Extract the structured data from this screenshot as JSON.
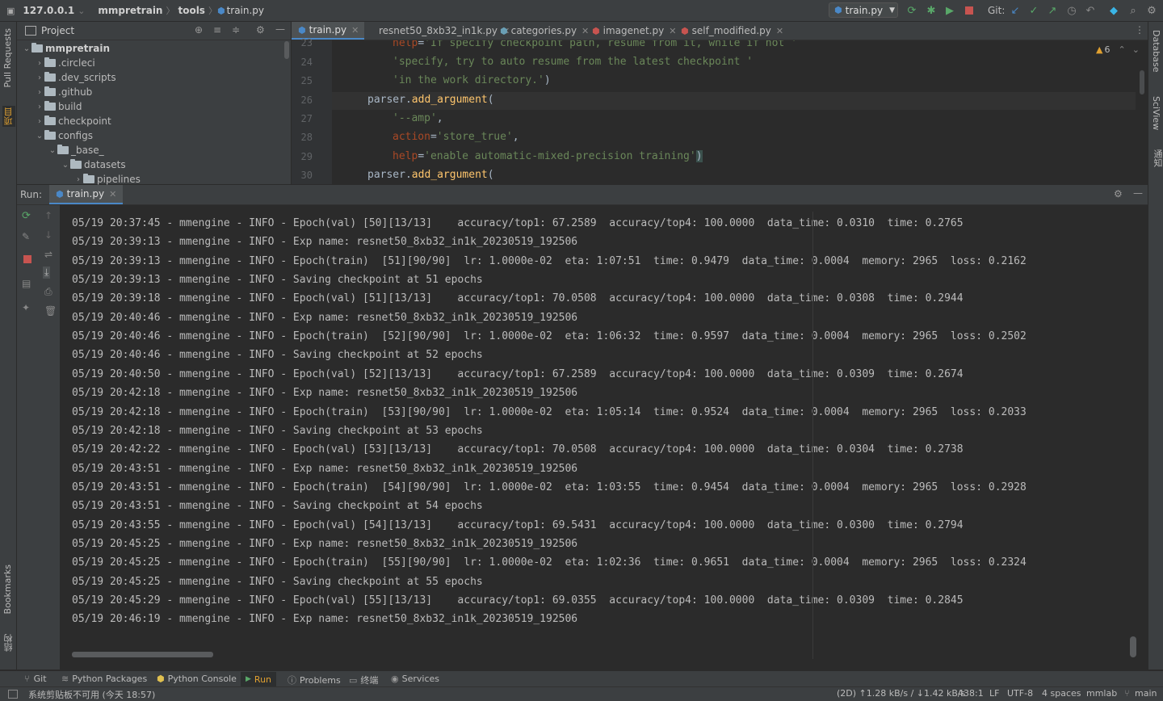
{
  "topbar": {
    "breadcrumbs": [
      "127.0.0.1",
      "mmpretrain",
      "tools",
      "train.py"
    ],
    "run_config": "train.py",
    "git_label": "Git:"
  },
  "left_stripe": {
    "pull_requests": "Pull Requests",
    "project": "项目",
    "bookmarks": "Bookmarks",
    "structure": "结构"
  },
  "right_stripe": {
    "database": "Database",
    "sciview": "SciView",
    "notifications": "通知"
  },
  "project": {
    "title": "Project",
    "tree": [
      {
        "label": "mmpretrain",
        "depth": 0,
        "open": true,
        "bold": true
      },
      {
        "label": ".circleci",
        "depth": 1,
        "open": false
      },
      {
        "label": ".dev_scripts",
        "depth": 1,
        "open": false
      },
      {
        "label": ".github",
        "depth": 1,
        "open": false
      },
      {
        "label": "build",
        "depth": 1,
        "open": false
      },
      {
        "label": "checkpoint",
        "depth": 1,
        "open": false
      },
      {
        "label": "configs",
        "depth": 1,
        "open": true
      },
      {
        "label": "_base_",
        "depth": 2,
        "open": true
      },
      {
        "label": "datasets",
        "depth": 3,
        "open": true
      },
      {
        "label": "pipelines",
        "depth": 4,
        "open": false
      }
    ]
  },
  "editor": {
    "tabs": [
      {
        "label": "train.py",
        "active": true
      },
      {
        "label": "resnet50_8xb32_in1k.py",
        "active": false
      },
      {
        "label": "categories.py",
        "active": false
      },
      {
        "label": "imagenet.py",
        "active": false
      },
      {
        "label": "self_modified.py",
        "active": false
      }
    ],
    "warnings": "6",
    "line_numbers": [
      "23",
      "24",
      "25",
      "26",
      "27",
      "28",
      "29",
      "30"
    ]
  },
  "run": {
    "label": "Run:",
    "tab": "train.py",
    "logs": [
      "05/19 20:37:45 - mmengine - INFO - Epoch(val) [50][13/13]    accuracy/top1: 67.2589  accuracy/top4: 100.0000  data_time: 0.0310  time: 0.2765",
      "05/19 20:39:13 - mmengine - INFO - Exp name: resnet50_8xb32_in1k_20230519_192506",
      "05/19 20:39:13 - mmengine - INFO - Epoch(train)  [51][90/90]  lr: 1.0000e-02  eta: 1:07:51  time: 0.9479  data_time: 0.0004  memory: 2965  loss: 0.2162",
      "05/19 20:39:13 - mmengine - INFO - Saving checkpoint at 51 epochs",
      "05/19 20:39:18 - mmengine - INFO - Epoch(val) [51][13/13]    accuracy/top1: 70.0508  accuracy/top4: 100.0000  data_time: 0.0308  time: 0.2944",
      "05/19 20:40:46 - mmengine - INFO - Exp name: resnet50_8xb32_in1k_20230519_192506",
      "05/19 20:40:46 - mmengine - INFO - Epoch(train)  [52][90/90]  lr: 1.0000e-02  eta: 1:06:32  time: 0.9597  data_time: 0.0004  memory: 2965  loss: 0.2502",
      "05/19 20:40:46 - mmengine - INFO - Saving checkpoint at 52 epochs",
      "05/19 20:40:50 - mmengine - INFO - Epoch(val) [52][13/13]    accuracy/top1: 67.2589  accuracy/top4: 100.0000  data_time: 0.0309  time: 0.2674",
      "05/19 20:42:18 - mmengine - INFO - Exp name: resnet50_8xb32_in1k_20230519_192506",
      "05/19 20:42:18 - mmengine - INFO - Epoch(train)  [53][90/90]  lr: 1.0000e-02  eta: 1:05:14  time: 0.9524  data_time: 0.0004  memory: 2965  loss: 0.2033",
      "05/19 20:42:18 - mmengine - INFO - Saving checkpoint at 53 epochs",
      "05/19 20:42:22 - mmengine - INFO - Epoch(val) [53][13/13]    accuracy/top1: 70.0508  accuracy/top4: 100.0000  data_time: 0.0304  time: 0.2738",
      "05/19 20:43:51 - mmengine - INFO - Exp name: resnet50_8xb32_in1k_20230519_192506",
      "05/19 20:43:51 - mmengine - INFO - Epoch(train)  [54][90/90]  lr: 1.0000e-02  eta: 1:03:55  time: 0.9454  data_time: 0.0004  memory: 2965  loss: 0.2928",
      "05/19 20:43:51 - mmengine - INFO - Saving checkpoint at 54 epochs",
      "05/19 20:43:55 - mmengine - INFO - Epoch(val) [54][13/13]    accuracy/top1: 69.5431  accuracy/top4: 100.0000  data_time: 0.0300  time: 0.2794",
      "05/19 20:45:25 - mmengine - INFO - Exp name: resnet50_8xb32_in1k_20230519_192506",
      "05/19 20:45:25 - mmengine - INFO - Epoch(train)  [55][90/90]  lr: 1.0000e-02  eta: 1:02:36  time: 0.9651  data_time: 0.0004  memory: 2965  loss: 0.2324",
      "05/19 20:45:25 - mmengine - INFO - Saving checkpoint at 55 epochs",
      "05/19 20:45:29 - mmengine - INFO - Epoch(val) [55][13/13]    accuracy/top1: 69.0355  accuracy/top4: 100.0000  data_time: 0.0309  time: 0.2845",
      "05/19 20:46:19 - mmengine - INFO - Exp name: resnet50_8xb32_in1k_20230519_192506"
    ]
  },
  "bottom_tools": [
    "Git",
    "Python Packages",
    "Python Console",
    "Run",
    "Problems",
    "终端",
    "Services"
  ],
  "status": {
    "message": "系统剪贴板不可用 (今天 18:57)",
    "transfer": "(2D) ↑1.28 kB/s / ↓1.42 kB/s",
    "position": "438:1",
    "line_sep": "LF",
    "encoding": "UTF-8",
    "indent": "4 spaces",
    "env": "mmlab",
    "branch": "main"
  },
  "colors": {
    "accent": "#4a88c7",
    "string": "#6a8759",
    "keyword": "#cc7832",
    "function": "#ffc66d",
    "param": "#aa4926",
    "stop": "#c75450",
    "run": "#59a869"
  }
}
